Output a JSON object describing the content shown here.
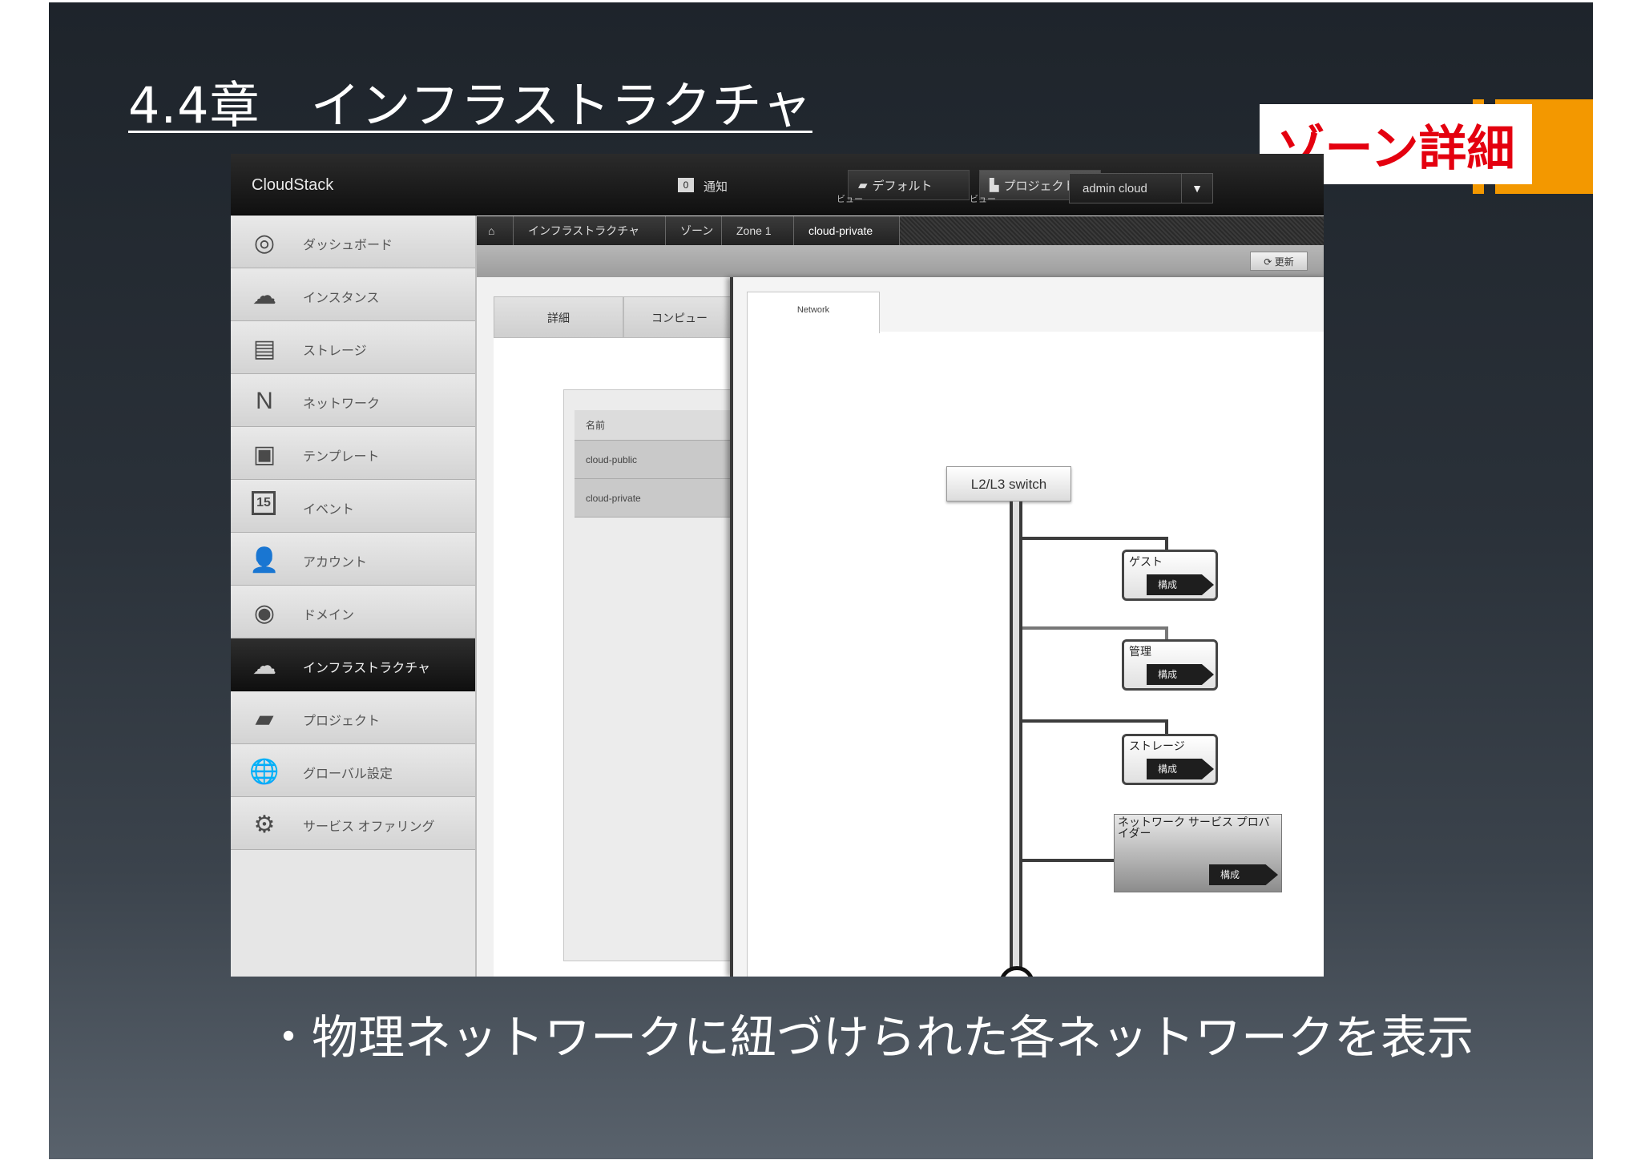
{
  "slide": {
    "title": "4.4章　インフラストラクチャ",
    "callout": "ゾーン詳細",
    "bullet": "・物理ネットワークに紐づけられた各ネットワークを表示",
    "colors": {
      "callout_text": "#e4000f",
      "callout_marker": "#f39800"
    }
  },
  "app": {
    "logo": "CloudStack",
    "notifications": {
      "count": "0",
      "label": "通知"
    },
    "default_view": {
      "label": "デフォルト",
      "sub": "ビュー",
      "icon": "folder-icon"
    },
    "project_view": {
      "label": "プロジェクト",
      "sub": "ビュー",
      "icon": "project-icon"
    },
    "user": {
      "name": "admin cloud",
      "caret": "▼"
    }
  },
  "sidebar": {
    "items": [
      {
        "label": "ダッシュボード",
        "icon": "dashboard-icon",
        "glyph": "◎"
      },
      {
        "label": "インスタンス",
        "icon": "cloud-icon",
        "glyph": "☁"
      },
      {
        "label": "ストレージ",
        "icon": "disk-icon",
        "glyph": "▤"
      },
      {
        "label": "ネットワーク",
        "icon": "network-icon",
        "glyph": "N"
      },
      {
        "label": "テンプレート",
        "icon": "template-icon",
        "glyph": "▣"
      },
      {
        "label": "イベント",
        "icon": "calendar-icon",
        "glyph": "15"
      },
      {
        "label": "アカウント",
        "icon": "user-icon",
        "glyph": "👤"
      },
      {
        "label": "ドメイン",
        "icon": "domain-icon",
        "glyph": "◉"
      },
      {
        "label": "インフラストラクチャ",
        "icon": "infrastructure-icon",
        "glyph": "☁",
        "active": true
      },
      {
        "label": "プロジェクト",
        "icon": "folder-icon",
        "glyph": "▰"
      },
      {
        "label": "グローバル設定",
        "icon": "globe-icon",
        "glyph": "🌐"
      },
      {
        "label": "サービス オファリング",
        "icon": "gear-icon",
        "glyph": "⚙"
      }
    ]
  },
  "breadcrumb": {
    "home_icon": "home-icon",
    "items": [
      "インフラストラクチャ",
      "ゾーン",
      "Zone 1",
      "cloud-private"
    ]
  },
  "toolbar": {
    "refresh": "更新",
    "refresh_icon": "refresh-icon"
  },
  "background_panel": {
    "tabs": [
      "詳細",
      "コンピュー"
    ],
    "list_header": "名前",
    "rows": [
      "cloud-public",
      "cloud-private"
    ]
  },
  "detail": {
    "tab": "Network",
    "switch": "L2/L3 switch",
    "networks": [
      {
        "label": "ゲスト",
        "button": "構成"
      },
      {
        "label": "管理",
        "button": "構成"
      },
      {
        "label": "ストレージ",
        "button": "構成"
      }
    ],
    "provider": {
      "label": "ネットワーク サービス プロバイダー",
      "button": "構成"
    }
  }
}
